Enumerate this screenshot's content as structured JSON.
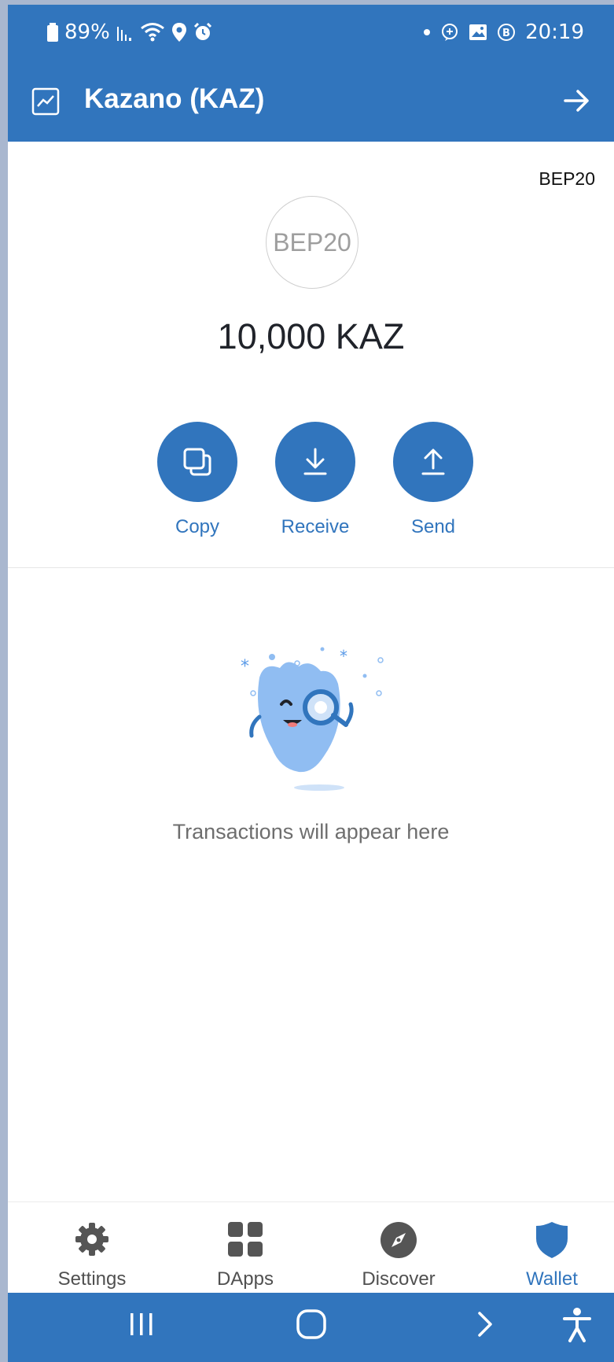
{
  "status_bar": {
    "battery": "89%",
    "time": "20:19"
  },
  "header": {
    "title": "Kazano (KAZ)"
  },
  "token": {
    "network": "BEP20",
    "logo_text": "BEP20",
    "balance": "10,000 KAZ"
  },
  "actions": {
    "copy": "Copy",
    "receive": "Receive",
    "send": "Send"
  },
  "empty_state": {
    "message": "Transactions will appear here"
  },
  "tabs": {
    "settings": "Settings",
    "dapps": "DApps",
    "discover": "Discover",
    "wallet": "Wallet",
    "active": "wallet"
  },
  "colors": {
    "brand": "#3175bd",
    "illustration": "#90bdf2"
  },
  "icons": {
    "chart": "chart-icon",
    "arrow": "arrow-right-icon",
    "copy": "copy-icon",
    "receive": "download-icon",
    "send": "upload-icon"
  }
}
